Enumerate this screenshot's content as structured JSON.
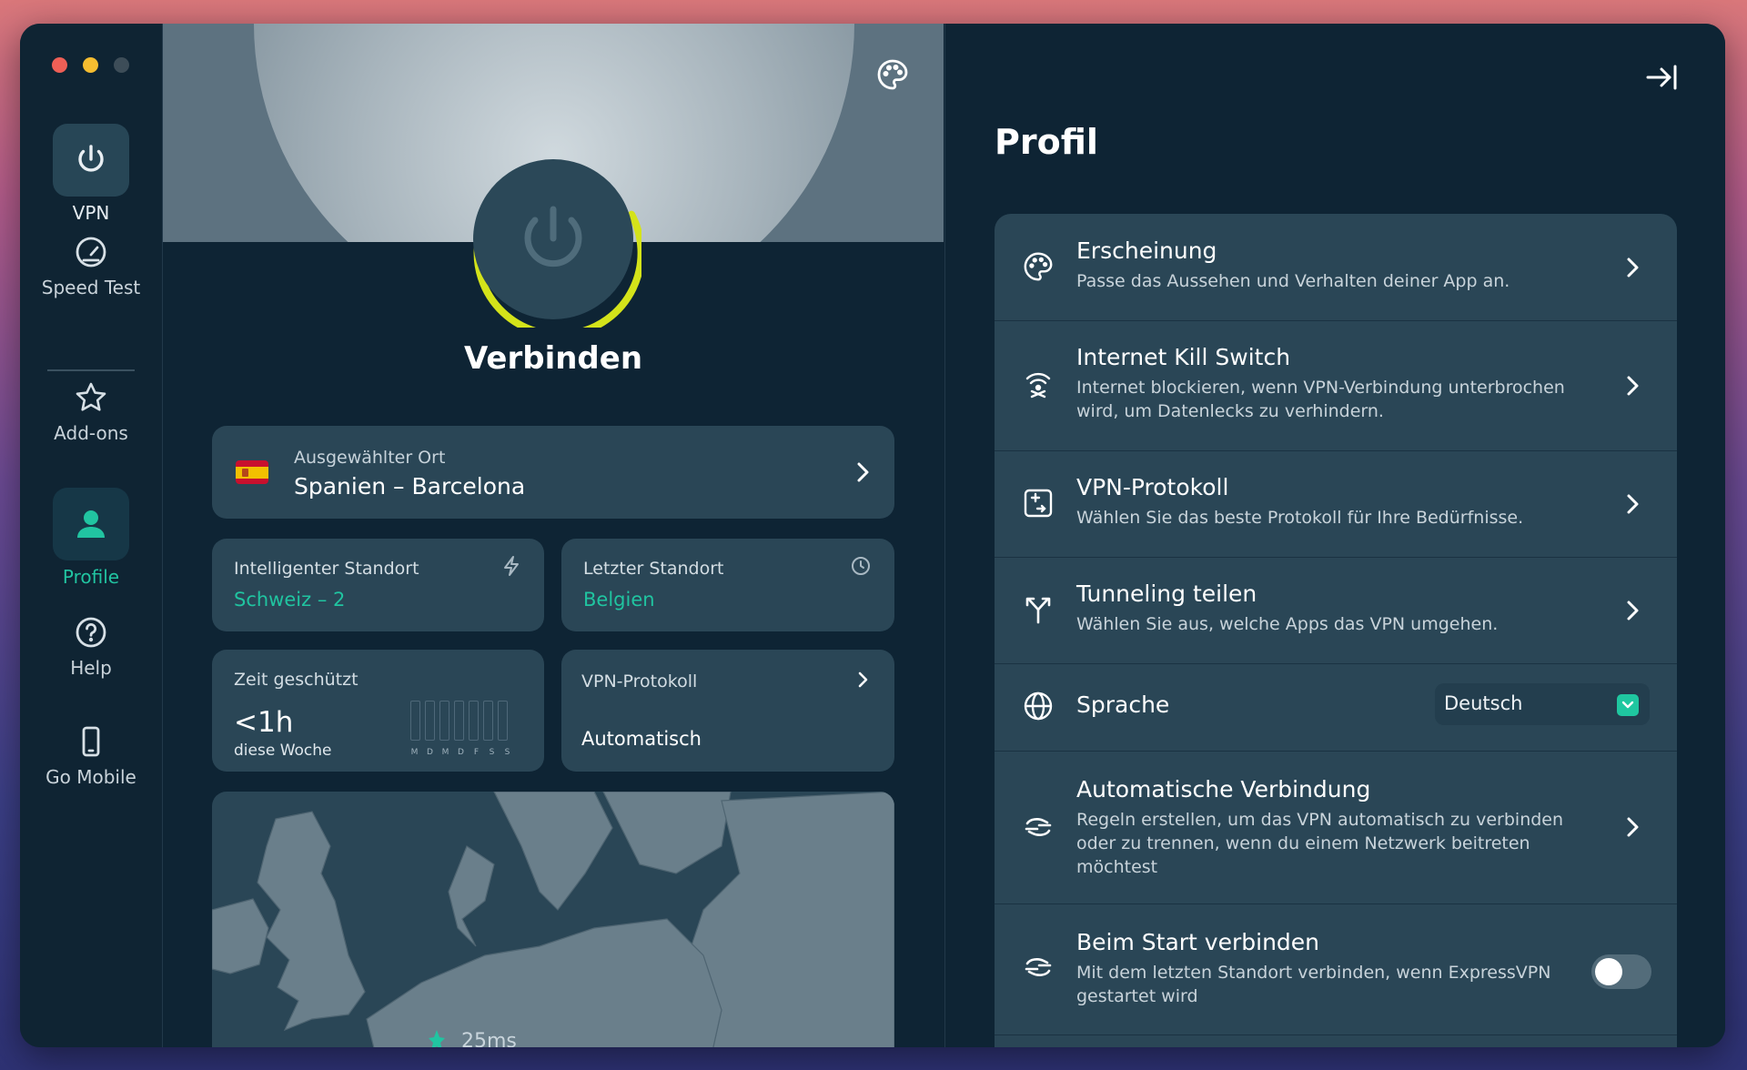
{
  "sidebar": {
    "items": [
      {
        "label": "VPN",
        "icon": "power-icon"
      },
      {
        "label": "Speed Test",
        "icon": "gauge-icon"
      },
      {
        "label": "Add-ons",
        "icon": "star-icon"
      },
      {
        "label": "Profile",
        "icon": "person-icon"
      },
      {
        "label": "Help",
        "icon": "help-icon"
      },
      {
        "label": "Go Mobile",
        "icon": "phone-icon"
      }
    ],
    "active": "Profile"
  },
  "center": {
    "connect_label": "Verbinden",
    "location": {
      "caption": "Ausgewählter Ort",
      "value": "Spanien – Barcelona",
      "flag": "spain-flag-icon"
    },
    "smart_location": {
      "title": "Intelligenter Standort",
      "value": "Schweiz – 2",
      "icon": "bolt-icon"
    },
    "last_location": {
      "title": "Letzter Standort",
      "value": "Belgien",
      "icon": "clock-icon"
    },
    "time_protected": {
      "title": "Zeit geschützt",
      "value": "<1h",
      "period": "diese Woche",
      "days": [
        "M",
        "D",
        "M",
        "D",
        "F",
        "S",
        "S"
      ]
    },
    "protocol": {
      "title": "VPN-Protokoll",
      "value": "Automatisch"
    },
    "map": {
      "ping_label": "25ms"
    }
  },
  "profile": {
    "title": "Profil",
    "rows": [
      {
        "title": "Erscheinung",
        "desc": "Passe das Aussehen und Verhalten deiner App an.",
        "icon": "palette-icon"
      },
      {
        "title": "Internet Kill Switch",
        "desc": "Internet blockieren, wenn VPN-Verbindung unterbrochen wird, um Datenlecks zu verhindern.",
        "icon": "kill-switch-icon"
      },
      {
        "title": "VPN-Protokoll",
        "desc": "Wählen Sie das beste Protokoll für Ihre Bedürfnisse.",
        "icon": "protocol-icon"
      },
      {
        "title": "Tunneling teilen",
        "desc": "Wählen Sie aus, welche Apps das VPN umgehen.",
        "icon": "split-icon"
      },
      {
        "title": "Sprache",
        "value": "Deutsch",
        "icon": "globe-icon"
      },
      {
        "title": "Automatische Verbindung",
        "desc": "Regeln erstellen, um das VPN automatisch zu verbinden oder zu trennen, wenn du einem Netzwerk beitreten möchtest",
        "icon": "auto-connect-icon"
      },
      {
        "title": "Beim Start verbinden",
        "desc": "Mit dem letzten Standort verbinden, wenn ExpressVPN gestartet wird",
        "icon": "startup-icon",
        "toggle": false
      }
    ]
  },
  "colors": {
    "accent": "#20c4a0",
    "ring": "#d4e31a",
    "panel": "#2a4656",
    "background": "#0e2434"
  }
}
